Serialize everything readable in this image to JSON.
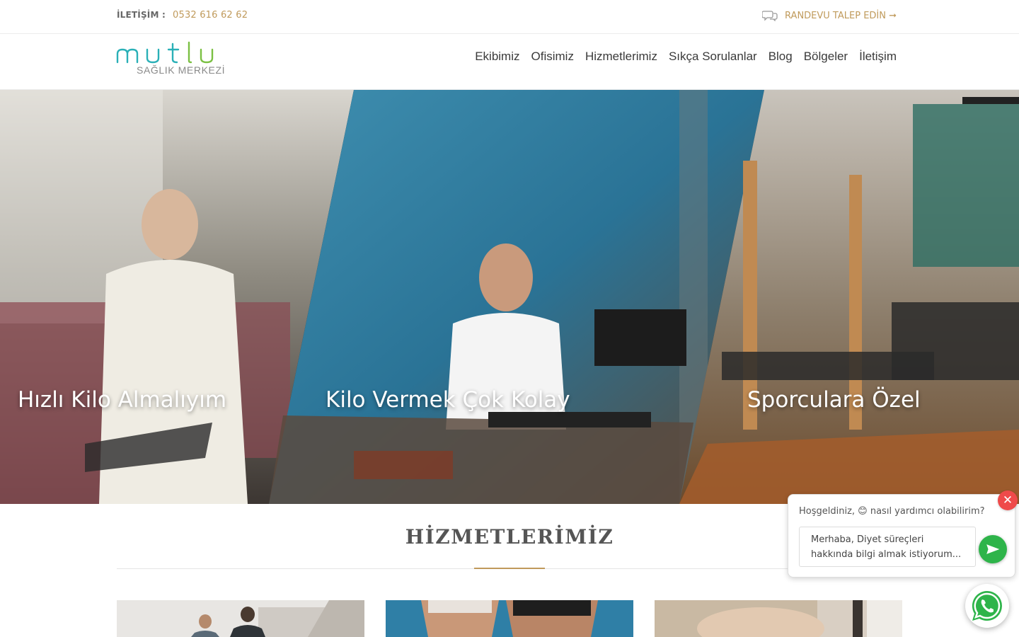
{
  "topbar": {
    "contact_label": "İLETİŞİM :",
    "phone": "0532 616 62 62",
    "appointment": "RANDEVU TALEP EDİN ➞"
  },
  "logo": {
    "word": "mutlu",
    "sub": "SAĞLIK MERKEZİ"
  },
  "nav": {
    "items": [
      "Ekibimiz",
      "Ofisimiz",
      "Hizmetlerimiz",
      "Sıkça Sorulanlar",
      "Blog",
      "Bölgeler",
      "İletişim"
    ]
  },
  "hero": {
    "slides": [
      {
        "title": "Hızlı Kilo Almalıyım"
      },
      {
        "title": "Kilo Vermek Çok Kolay"
      },
      {
        "title": "Sporculara Özel"
      }
    ]
  },
  "services": {
    "title": "HİZMETLERİMİZ"
  },
  "chat": {
    "greeting": "Hoşgeldiniz, 😊 nasıl yardımcı olabilirim?",
    "message": "Merhaba, Diyet süreçleri hakkında bilgi almak istiyorum..."
  },
  "colors": {
    "accent": "#c09a5b",
    "logo_teal": "#2ab0b7",
    "whatsapp": "#2eb44a",
    "close": "#ef4a4a"
  }
}
